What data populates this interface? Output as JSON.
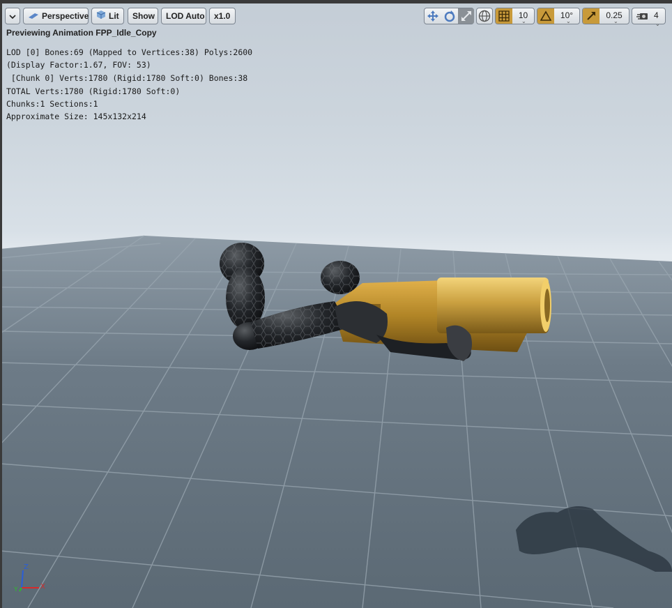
{
  "toolbar": {
    "menu_icon": "chevron-down-icon",
    "perspective_label": "Perspective",
    "lit_label": "Lit",
    "show_label": "Show",
    "lod_label": "LOD Auto",
    "speed_label": "x1.0",
    "grid_snap_value": "10",
    "rotation_snap_value": "10°",
    "scale_snap_value": "0.25",
    "camera_speed_value": "4",
    "accent_color": "#c89a3a"
  },
  "overlay": {
    "title": "Previewing Animation FPP_Idle_Copy",
    "stats": [
      "LOD [0] Bones:69 (Mapped to Vertices:38) Polys:2600",
      "(Display Factor:1.67, FOV: 53)",
      " [Chunk 0] Verts:1780 (Rigid:1780 Soft:0) Bones:38",
      "TOTAL Verts:1780 (Rigid:1780 Soft:0)",
      "Chunks:1 Sections:1",
      "Approximate Size: 145x132x214"
    ]
  },
  "axis": {
    "z": "Z",
    "x": "X",
    "y": "Y"
  }
}
